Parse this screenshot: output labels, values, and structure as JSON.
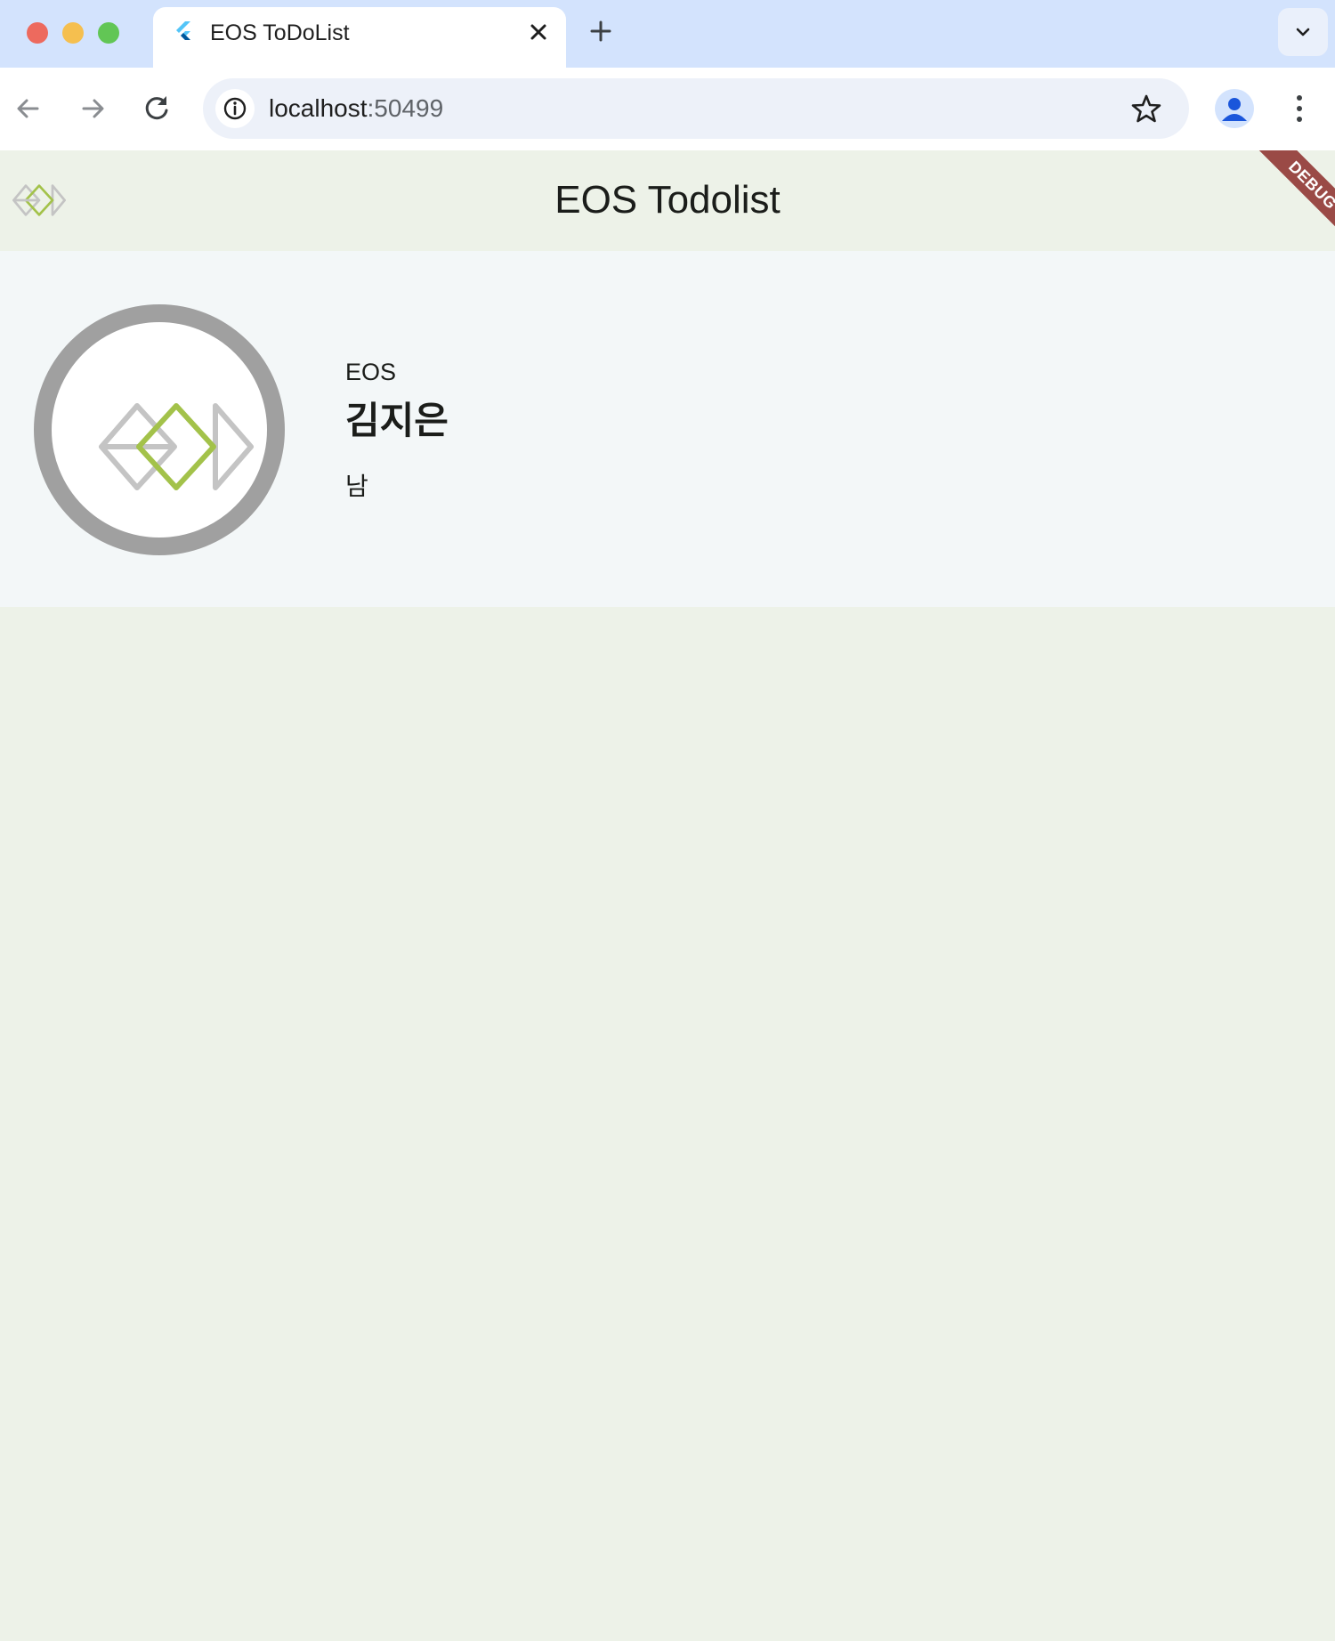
{
  "browser": {
    "tab_title": "EOS ToDoList",
    "url_host": "localhost",
    "url_port": ":50499",
    "traffic_colors": [
      "#ed6a5e",
      "#f5bf4f",
      "#62c655"
    ]
  },
  "app": {
    "title": "EOS Todolist",
    "debug_banner": "DEBUG",
    "colors": {
      "logo_gray": "#c4c4c4",
      "logo_green": "#a3c24a",
      "appbar_bg": "#edf2e8",
      "card_bg": "#f3f7f8",
      "avatar_ring": "#a0a0a0"
    }
  },
  "profile": {
    "organization": "EOS",
    "name": "김지은",
    "gender": "남"
  },
  "icons": {
    "tab_favicon": "flutter-icon",
    "back": "arrow-left-icon",
    "forward": "arrow-right-icon",
    "reload": "reload-icon",
    "info": "info-icon",
    "bookmark": "star-icon",
    "profile": "person-icon",
    "menu": "kebab-menu-icon",
    "new_tab": "plus-icon",
    "close_tab": "close-icon",
    "tab_list": "chevron-down-icon"
  }
}
